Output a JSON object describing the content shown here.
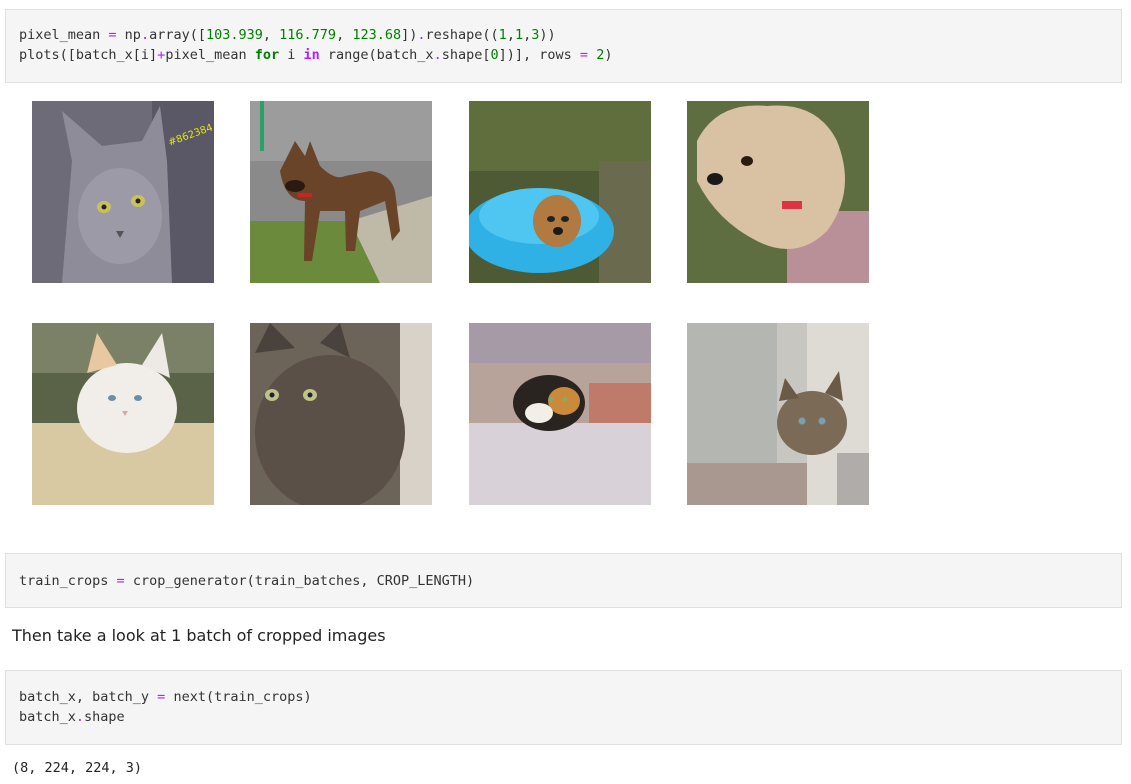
{
  "cell1": {
    "line1": {
      "a": "pixel_mean ",
      "b": "=",
      "c": " np",
      "d": ".",
      "e": "array([",
      "f": "103.939",
      "g": ", ",
      "h": "116.779",
      "i": ", ",
      "j": "123.68",
      "k": "])",
      "l": ".",
      "m": "reshape((",
      "n": "1",
      "o": ",",
      "p": "1",
      "q": ",",
      "r": "3",
      "s": "))"
    },
    "line2": {
      "a": "plots([batch_x[i]",
      "b": "+",
      "c": "pixel_mean ",
      "d": "for",
      "e": " i ",
      "f": "in",
      "g": " range(batch_x",
      "h": ".",
      "i": "shape[",
      "j": "0",
      "k": "])], rows ",
      "l": "=",
      "m": " ",
      "n": "2",
      "o": ")"
    }
  },
  "images": [
    {
      "label": "grey-cat",
      "watermark": "#862384"
    },
    {
      "label": "brindle-dog"
    },
    {
      "label": "puppy-in-blue-pool"
    },
    {
      "label": "fluffy-terrier"
    },
    {
      "label": "white-kitten"
    },
    {
      "label": "tortoiseshell-cat"
    },
    {
      "label": "calico-kitten"
    },
    {
      "label": "tabby-kitten"
    }
  ],
  "cell2": {
    "a": "train_crops ",
    "b": "=",
    "c": " crop_generator(train_batches, CROP_LENGTH)"
  },
  "markdown": {
    "text": "Then take a look at 1 batch of cropped images"
  },
  "cell3": {
    "line1": {
      "a": "batch_x, batch_y ",
      "b": "=",
      "c": " next(train_crops)"
    },
    "line2": {
      "a": "batch_x",
      "b": ".",
      "c": "shape"
    }
  },
  "output": {
    "text": "(8, 224, 224, 3)"
  },
  "colors": {
    "operator": "#aa22ff",
    "number": "#008000",
    "keyword": "#008000",
    "cell_bg": "#f5f5f5"
  }
}
